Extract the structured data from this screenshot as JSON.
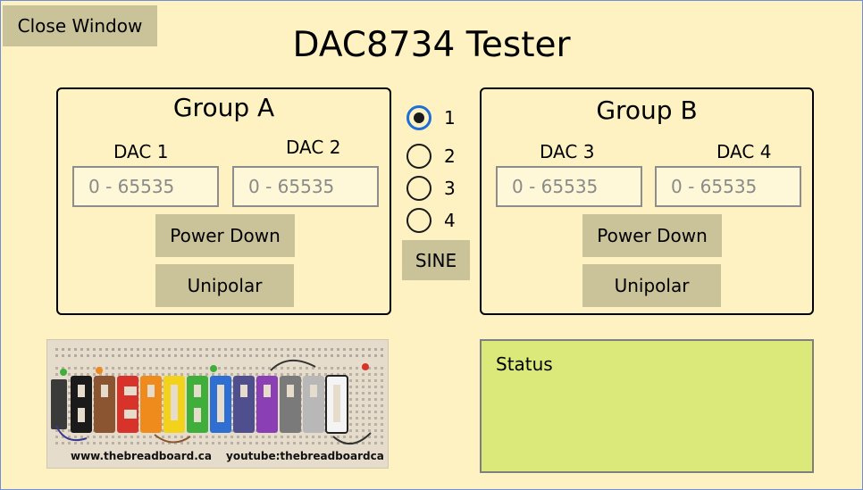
{
  "window": {
    "close_label": "Close Window",
    "title": "DAC8734 Tester"
  },
  "group_a": {
    "title": "Group A",
    "dac1": {
      "label": "DAC 1",
      "placeholder": "0 - 65535",
      "value": ""
    },
    "dac2": {
      "label": "DAC 2",
      "placeholder": "0 - 65535",
      "value": ""
    },
    "power_down_label": "Power Down",
    "unipolar_label": "Unipolar"
  },
  "group_b": {
    "title": "Group B",
    "dac3": {
      "label": "DAC 3",
      "placeholder": "0 - 65535",
      "value": ""
    },
    "dac4": {
      "label": "DAC 4",
      "placeholder": "0 - 65535",
      "value": ""
    },
    "power_down_label": "Power Down",
    "unipolar_label": "Unipolar"
  },
  "channel_select": {
    "options": [
      "1",
      "2",
      "3",
      "4"
    ],
    "selected": "1"
  },
  "sine_label": "SINE",
  "logo": {
    "text": "THEBREADBOARD",
    "website": "www.thebreadboard.ca",
    "youtube": "youtube:thebreadboardca"
  },
  "status": {
    "label": "Status"
  },
  "colors": {
    "background": "#fff2c2",
    "button": "#cac39a",
    "status_background": "#dbe87a",
    "radio_accent": "#1f6fd4"
  }
}
